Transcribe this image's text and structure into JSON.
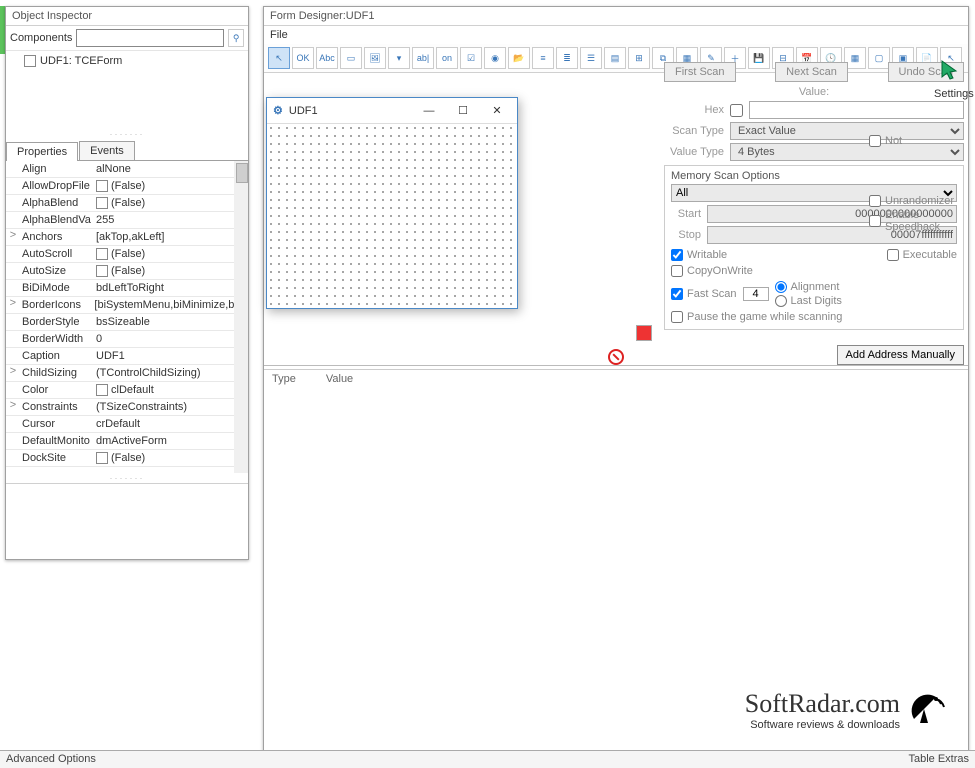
{
  "object_inspector": {
    "title": "Object Inspector",
    "components_label": "Components",
    "tree_item": "UDF1: TCEForm",
    "tabs": {
      "properties": "Properties",
      "events": "Events"
    },
    "props": [
      {
        "exp": "",
        "k": "Align",
        "v": "alNone",
        "chk": false
      },
      {
        "exp": "",
        "k": "AllowDropFile",
        "v": "(False)",
        "chk": true
      },
      {
        "exp": "",
        "k": "AlphaBlend",
        "v": "(False)",
        "chk": true
      },
      {
        "exp": "",
        "k": "AlphaBlendVa",
        "v": "255",
        "chk": false
      },
      {
        "exp": ">",
        "k": "Anchors",
        "v": "[akTop,akLeft]",
        "chk": false
      },
      {
        "exp": "",
        "k": "AutoScroll",
        "v": "(False)",
        "chk": true
      },
      {
        "exp": "",
        "k": "AutoSize",
        "v": "(False)",
        "chk": true
      },
      {
        "exp": "",
        "k": "BiDiMode",
        "v": "bdLeftToRight",
        "chk": false
      },
      {
        "exp": ">",
        "k": "BorderIcons",
        "v": "[biSystemMenu,biMinimize,biM",
        "chk": false
      },
      {
        "exp": "",
        "k": "BorderStyle",
        "v": "bsSizeable",
        "chk": false
      },
      {
        "exp": "",
        "k": "BorderWidth",
        "v": "0",
        "chk": false
      },
      {
        "exp": "",
        "k": "Caption",
        "v": "UDF1",
        "chk": false
      },
      {
        "exp": ">",
        "k": "ChildSizing",
        "v": "(TControlChildSizing)",
        "chk": false
      },
      {
        "exp": "",
        "k": "Color",
        "v": "clDefault",
        "chk": true
      },
      {
        "exp": ">",
        "k": "Constraints",
        "v": "(TSizeConstraints)",
        "chk": false
      },
      {
        "exp": "",
        "k": "Cursor",
        "v": "crDefault",
        "chk": false
      },
      {
        "exp": "",
        "k": "DefaultMonito",
        "v": "dmActiveForm",
        "chk": false
      },
      {
        "exp": "",
        "k": "DockSite",
        "v": "(False)",
        "chk": true
      }
    ]
  },
  "form_designer": {
    "title": "Form Designer:UDF1",
    "menu_file": "File",
    "udf1_caption": "UDF1",
    "toolbar_icons": [
      "pointer",
      "ok-btn",
      "abc-label",
      "panel",
      "img",
      "combobox",
      "abl",
      "on",
      "chk-icon",
      "radio",
      "open",
      "lines1",
      "lines2",
      "lines3",
      "list",
      "tree",
      "winset",
      "grid",
      "pen",
      "plus",
      "save-disk",
      "trackbar",
      "calendar",
      "clock",
      "table",
      "box1",
      "box2",
      "doc",
      "ptr2"
    ]
  },
  "scan": {
    "first": "First Scan",
    "next": "Next Scan",
    "undo": "Undo Scan",
    "settings": "Settings",
    "value_lbl": "Value:",
    "hex_lbl": "Hex",
    "scantype_lbl": "Scan Type",
    "scantype_val": "Exact Value",
    "valuetype_lbl": "Value Type",
    "valuetype_val": "4 Bytes",
    "not": "Not",
    "mso_title": "Memory Scan Options",
    "mso_all": "All",
    "start_lbl": "Start",
    "start_val": "0000000000000000",
    "stop_lbl": "Stop",
    "stop_val": "00007fffffffffff",
    "writable": "Writable",
    "executable": "Executable",
    "cow": "CopyOnWrite",
    "fastscan": "Fast Scan",
    "fastscan_val": "4",
    "alignment": "Alignment",
    "lastdigits": "Last Digits",
    "pause": "Pause the game while scanning",
    "unrand": "Unrandomizer",
    "speedhack": "Enable Speedhack",
    "addaddr": "Add Address Manually"
  },
  "results": {
    "type": "Type",
    "value": "Value"
  },
  "brand": {
    "main": "SoftRadar.com",
    "sub": "Software reviews & downloads"
  },
  "status": {
    "left": "Advanced Options",
    "right": "Table Extras"
  }
}
